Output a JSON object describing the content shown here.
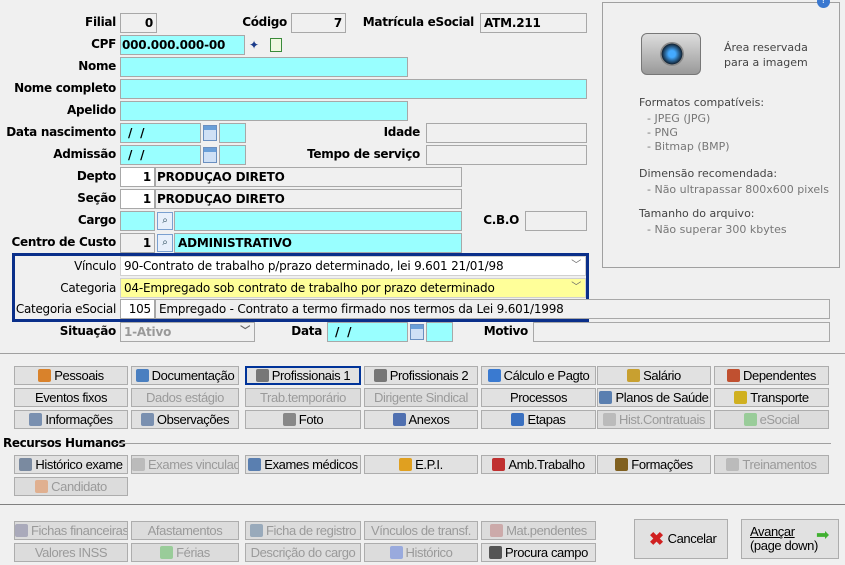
{
  "form": {
    "filial": {
      "label": "Filial",
      "value": "0"
    },
    "codigo": {
      "label": "Código",
      "value": "7"
    },
    "matricula": {
      "label": "Matrícula eSocial",
      "value": "ATM.211"
    },
    "cpf": {
      "label": "CPF",
      "value": "000.000.000-00"
    },
    "nome": {
      "label": "Nome",
      "value": ""
    },
    "nome_completo": {
      "label": "Nome completo",
      "value": ""
    },
    "apelido": {
      "label": "Apelido",
      "value": ""
    },
    "data_nascimento": {
      "label": "Data nascimento",
      "value": " /  /"
    },
    "idade": {
      "label": "Idade",
      "value": ""
    },
    "admissao": {
      "label": "Admissão",
      "value": " /  /"
    },
    "tempo_servico": {
      "label": "Tempo de serviço",
      "value": ""
    },
    "depto": {
      "label": "Depto",
      "code": "1",
      "value": "PRODUÇAO DIRETO"
    },
    "secao": {
      "label": "Seção",
      "code": "1",
      "value": "PRODUÇAO DIRETO"
    },
    "cargo": {
      "label": "Cargo",
      "code": "",
      "value": ""
    },
    "cbo": {
      "label": "C.B.O",
      "value": ""
    },
    "centro_custo": {
      "label": "Centro de Custo",
      "code": "1",
      "value": "ADMINISTRATIVO"
    },
    "vinculo": {
      "label": "Vínculo",
      "value": "90-Contrato de trabalho p/prazo determinado, lei 9.601 21/01/98"
    },
    "categoria": {
      "label": "Categoria",
      "value": "04-Empregado sob contrato de trabalho por prazo determinado"
    },
    "categoria_esocial": {
      "label": "Categoria eSocial",
      "code": "105",
      "value": "Empregado - Contrato a termo firmado nos termos da Lei 9.601/1998"
    },
    "situacao": {
      "label": "Situação",
      "value": "1-Ativo"
    },
    "data": {
      "label": "Data",
      "value": " /  /"
    },
    "motivo": {
      "label": "Motivo",
      "value": ""
    }
  },
  "image_panel": {
    "title1": "Área reservada",
    "title2": "para a imagem",
    "formats_title": "Formatos compatíveis:",
    "formats": [
      "- JPEG (JPG)",
      "- PNG",
      "- Bitmap (BMP)"
    ],
    "dim_title": "Dimensão recomendada:",
    "dim": "- Não ultrapassar 800x600 pixels",
    "size_title": "Tamanho do arquivo:",
    "size": "- Não superar 300 kbytes"
  },
  "tabs": [
    [
      {
        "label": "Pessoais",
        "icon": "person-icon",
        "c": "#d9822b"
      },
      {
        "label": "Documentação",
        "icon": "document-icon",
        "c": "#4a7fc0"
      },
      {
        "label": "Profissionais 1",
        "icon": "briefcase-icon",
        "c": "#777",
        "hl": true
      },
      {
        "label": "Profissionais 2",
        "icon": "briefcase-icon",
        "c": "#777"
      },
      {
        "label": "Cálculo e Pagto",
        "icon": "calculator-icon",
        "c": "#3a7ad0"
      },
      {
        "label": "Salário",
        "icon": "money-bag-icon",
        "c": "#c8a030"
      },
      {
        "label": "Dependentes",
        "icon": "people-icon",
        "c": "#c05030"
      }
    ],
    [
      {
        "label": "Eventos fixos"
      },
      {
        "label": "Dados estágio",
        "dis": true
      },
      {
        "label": "Trab.temporário",
        "dis": true
      },
      {
        "label": "Dirigente Sindical",
        "dis": true
      },
      {
        "label": "Processos"
      },
      {
        "label": "Planos de Saúde",
        "icon": "ambulance-icon",
        "c": "#5a7fb0"
      },
      {
        "label": "Transporte",
        "icon": "bus-icon",
        "c": "#d0b020"
      }
    ],
    [
      {
        "label": "Informações",
        "icon": "page-icon",
        "c": "#7a90b0"
      },
      {
        "label": "Observações",
        "icon": "page-icon",
        "c": "#7a90b0"
      },
      {
        "label": "Foto",
        "icon": "camera-icon",
        "c": "#888"
      },
      {
        "label": "Anexos",
        "icon": "paperclip-icon",
        "c": "#5070b0"
      },
      {
        "label": "Etapas",
        "icon": "checklist-icon",
        "c": "#3a70c0"
      },
      {
        "label": "Hist.Contratuais",
        "icon": "stethoscope-icon",
        "c": "#bbb",
        "dis": true
      },
      {
        "label": "eSocial",
        "icon": "file-icon",
        "c": "#9c9",
        "dis": true
      }
    ]
  ],
  "rh": {
    "title": "Recursos Humanos",
    "buttons": [
      [
        {
          "label": "Histórico exame",
          "icon": "stethoscope-icon",
          "c": "#7a8aa0"
        },
        {
          "label": "Exames vinculados",
          "icon": "stethoscope-icon",
          "c": "#bbb",
          "dis": true
        },
        {
          "label": "Exames médicos",
          "icon": "ambulance-icon",
          "c": "#5a7fb0"
        },
        {
          "label": "E.P.I.",
          "icon": "worker-icon",
          "c": "#e0a020"
        },
        {
          "label": "Amb.Trabalho",
          "icon": "toolbox-icon",
          "c": "#c03030"
        },
        {
          "label": "Formações",
          "icon": "graduation-icon",
          "c": "#806020"
        },
        {
          "label": "Treinamentos",
          "icon": "stethoscope-icon",
          "c": "#bbb",
          "dis": true
        }
      ],
      [
        {
          "label": "Candidato",
          "icon": "person-icon",
          "c": "#e0b090",
          "dis": true
        }
      ]
    ]
  },
  "bottom": [
    [
      {
        "label": "Fichas financeiras",
        "icon": "sheet-icon",
        "c": "#aab",
        "dis": true
      },
      {
        "label": "Afastamentos",
        "dis": true
      },
      {
        "label": "Ficha de registro",
        "icon": "document-icon",
        "c": "#9ab",
        "dis": true
      },
      {
        "label": "Vínculos de transf.",
        "dis": true
      },
      {
        "label": "Mat.pendentes",
        "icon": "tools-icon",
        "c": "#caa",
        "dis": true
      }
    ],
    [
      {
        "label": "Valores INSS",
        "dis": true
      },
      {
        "label": "Férias",
        "icon": "picture-icon",
        "c": "#9c9",
        "dis": true
      },
      {
        "label": "Descrição do cargo",
        "dis": true
      },
      {
        "label": "Histórico",
        "icon": "clock-icon",
        "c": "#9ad",
        "dis": true
      },
      {
        "label": "Procura campo",
        "icon": "binoculars-icon",
        "c": "#555"
      }
    ]
  ],
  "actions": {
    "cancel": "Cancelar",
    "next1": "Avançar",
    "next2": "(page down)"
  }
}
